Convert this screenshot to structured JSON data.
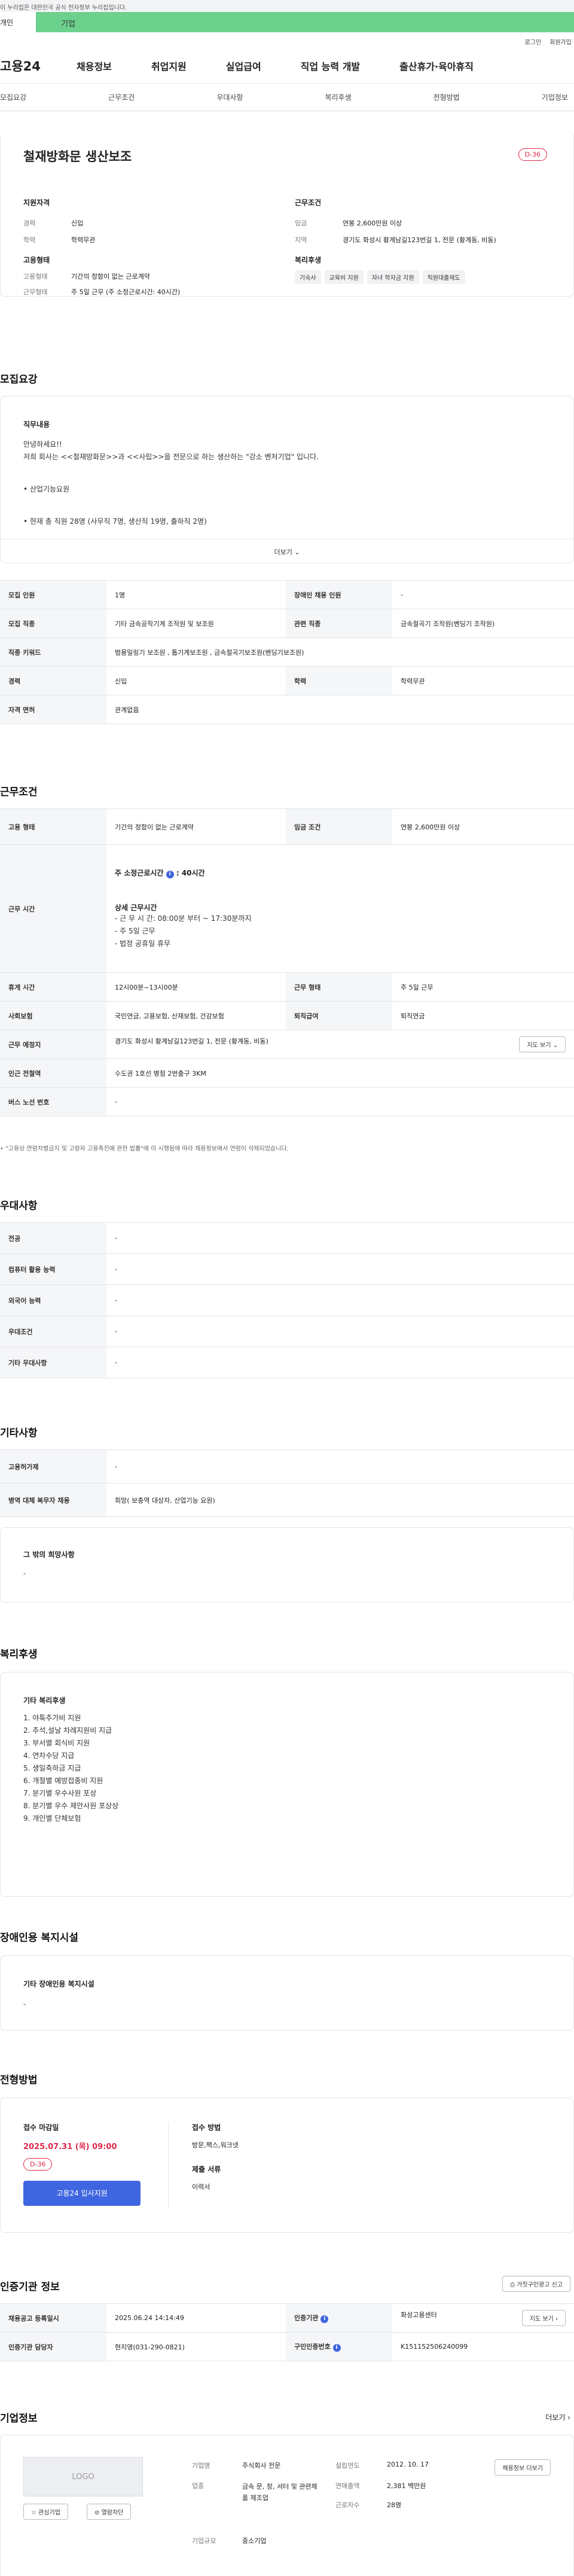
{
  "gov_banner": "이 누리집은 대한민국 공식 전자정부 누리집입니다.",
  "category_tabs": [
    "개인",
    "기업"
  ],
  "utility": [
    "로그인",
    "회원가입"
  ],
  "logo": "고용24",
  "gnb": [
    "채용정보",
    "취업지원",
    "실업급여",
    "직업 능력 개발",
    "출산휴가·육아휴직"
  ],
  "subnav": [
    "모집요강",
    "근무조건",
    "우대사항",
    "복리후생",
    "전형방법",
    "기업정보"
  ],
  "summary": {
    "title": "철재방화문 생산보조",
    "dday": "D-36",
    "qual_head": "지원자격",
    "qual": [
      {
        "label": "경력",
        "value": "신입"
      },
      {
        "label": "학력",
        "value": "학력무관"
      }
    ],
    "cond_head": "근무조건",
    "cond": [
      {
        "label": "임금",
        "value": "연봉 2,600만원 이상"
      },
      {
        "label": "지역",
        "value": "경기도 화성시 황계남길123번길 1, 전문 (황계동, 비동)"
      }
    ],
    "emp_head": "고용형태",
    "emp": [
      {
        "label": "고용형태",
        "value": "기간의 정함이 없는 근로계약"
      },
      {
        "label": "근무형태",
        "value": "주 5일 근무 (주 소정근로시간: 40시간)"
      }
    ],
    "welfare_head": "복리후생",
    "welfare_tags": [
      "기숙사",
      "교육비 지원",
      "자녀 학자금 지원",
      "직원대출제도"
    ]
  },
  "recruit": {
    "heading": "모집요강",
    "duty_title": "직무내용",
    "duty_lines": [
      "안녕하세요!!",
      "저희 회사는 <<철재방화문>>과 <<사립>>을 전문으로 하는 생산하는 \"강소 벤처기업\" 입니다.",
      "",
      "• 산업기능요원",
      "",
      "• 현재 총 직원 28명 (사무직 7명, 생산직 19명, 출하직 2명)"
    ],
    "more": "더보기",
    "table": [
      [
        "모집 인원",
        "1명",
        "장애인 채용 인원",
        "-"
      ],
      [
        "모집 직종",
        "기타 금속공작기계 조작원 및 보조원",
        "관련 직종",
        "금속절곡기 조작원(벤딩기 조작원)"
      ],
      [
        "직종 키워드",
        "범용밀링기 보조원 , 톱기계보조원 , 금속절곡기보조원(벤딩기보조원)",
        "",
        ""
      ],
      [
        "경력",
        "신입",
        "학력",
        "학력무관"
      ],
      [
        "자격 면허",
        "관계없음",
        "",
        ""
      ]
    ]
  },
  "work": {
    "heading": "근무조건",
    "emp_type_label": "고용 형태",
    "emp_type": "기간의 정함이 없는 근로계약",
    "wage_label": "임금 조건",
    "wage": "연봉 2,600만원 이상",
    "hours_label": "근무 시간",
    "hours_week": "주 소정근로시간",
    "hours_week_value": "40시간",
    "hours_detail_title": "상세 근무시간",
    "hours_detail": [
      "- 근 무 시 간: 08:00분 부터 ~ 17:30분까지",
      "- 주 5일 근무",
      "- 법정 공휴일 휴무"
    ],
    "rest_label": "휴게 시간",
    "rest": "12시00분~13시00분",
    "shift_label": "근무 형태",
    "shift": "주 5일 근무",
    "ins_label": "사회보험",
    "ins": "국민연금, 고용보험, 산재보험, 건강보험",
    "pension_label": "퇴직급여",
    "pension": "퇴직연금",
    "place_label": "근무 예정지",
    "place": "경기도 화성시 황계남길123번길 1, 전문 (황계동, 비동)",
    "map_btn": "지도 보기",
    "station_label": "인근 전철역",
    "station": "수도권 1호선 병점 2번출구 3KM",
    "bus_label": "버스 노선 번호",
    "bus": "-",
    "notice": "\"고용상 연령차별금지 및 고령자 고용촉진에 관한 법률\"에 이 시행됨에 따라 채용정보에서 연령이 삭제되었습니다."
  },
  "prefer": {
    "heading": "우대사항",
    "rows": [
      [
        "전공",
        "-"
      ],
      [
        "컴퓨터 활용 능력",
        "-"
      ],
      [
        "외국어 능력",
        "-"
      ],
      [
        "우대조건",
        "-"
      ],
      [
        "기타 우대사항",
        "-"
      ]
    ]
  },
  "etc": {
    "heading": "기타사항",
    "rows": [
      [
        "고용허가제",
        "-"
      ],
      [
        "병역 대체 복무자 채용",
        "희망( 보충역 대상자, 산업기능 요원)"
      ]
    ],
    "hope_title": "그 밖의 희망사항",
    "hope_value": "-"
  },
  "welfare": {
    "heading": "복리후생",
    "title": "기타 복리후생",
    "items": [
      "1. 야툭추가비 지원",
      "2. 추석,설날 차례지원비 지급",
      "3. 부서별 회식비 지원",
      "4. 연차수당 지급",
      "5. 생일축하금 지급",
      "6. 개절별 예방접종비 지원",
      "7. 분기별 우수사원 포상",
      "8. 분기별 우수 제안사원 포상상",
      "9. 개인별 단체보험"
    ]
  },
  "disability": {
    "heading": "장애인용 복지시설",
    "title": "기타 장애인용 복지시설",
    "value": "-"
  },
  "selection": {
    "heading": "전형방법",
    "deadline_label": "접수 마감일",
    "deadline": "2025.07.31 (목) 09:00",
    "dday": "D-36",
    "apply": "고용24 입사지원",
    "method_label": "접수 방법",
    "method": "방문,팩스,워크넷",
    "docs_label": "제출 서류",
    "docs": "이력서"
  },
  "agency": {
    "heading": "인증기관 정보",
    "report_btn": "거짓구인광고 신고",
    "reg_label": "채용공고 등록일시",
    "reg": "2025.06.24 14:14:49",
    "org_label": "인증기관",
    "org": "화성고용센터",
    "map_btn": "지도 보기",
    "staff_label": "인증기관 담당자",
    "staff": "현지영(031-290-0821)",
    "id_label": "구인인증번호",
    "id": "K151152506240099"
  },
  "company": {
    "heading": "기업정보",
    "more": "더보기",
    "logo_text": "LOGO",
    "interest_btn": "관심기업",
    "block_btn": "열람차단",
    "info_btn": "채용정보 더보기",
    "rows": [
      {
        "label": "기업명",
        "value": "주식회사 전문"
      },
      {
        "label": "업종",
        "value": "금속 문, 창, 셔터 및 관련제품 제조업"
      },
      {
        "label": "기업규모",
        "value": "중소기업"
      }
    ],
    "rows2": [
      {
        "label": "설립연도",
        "value": "2012. 10. 17"
      },
      {
        "label": "연매출액",
        "value": "2,381 백만원"
      },
      {
        "label": "근로자수",
        "value": "28명"
      }
    ]
  },
  "colors": {
    "accent": "#6dd18e",
    "dday": "#e0294a",
    "apply": "#3f66e0",
    "info_dot": "#3f66e0"
  }
}
